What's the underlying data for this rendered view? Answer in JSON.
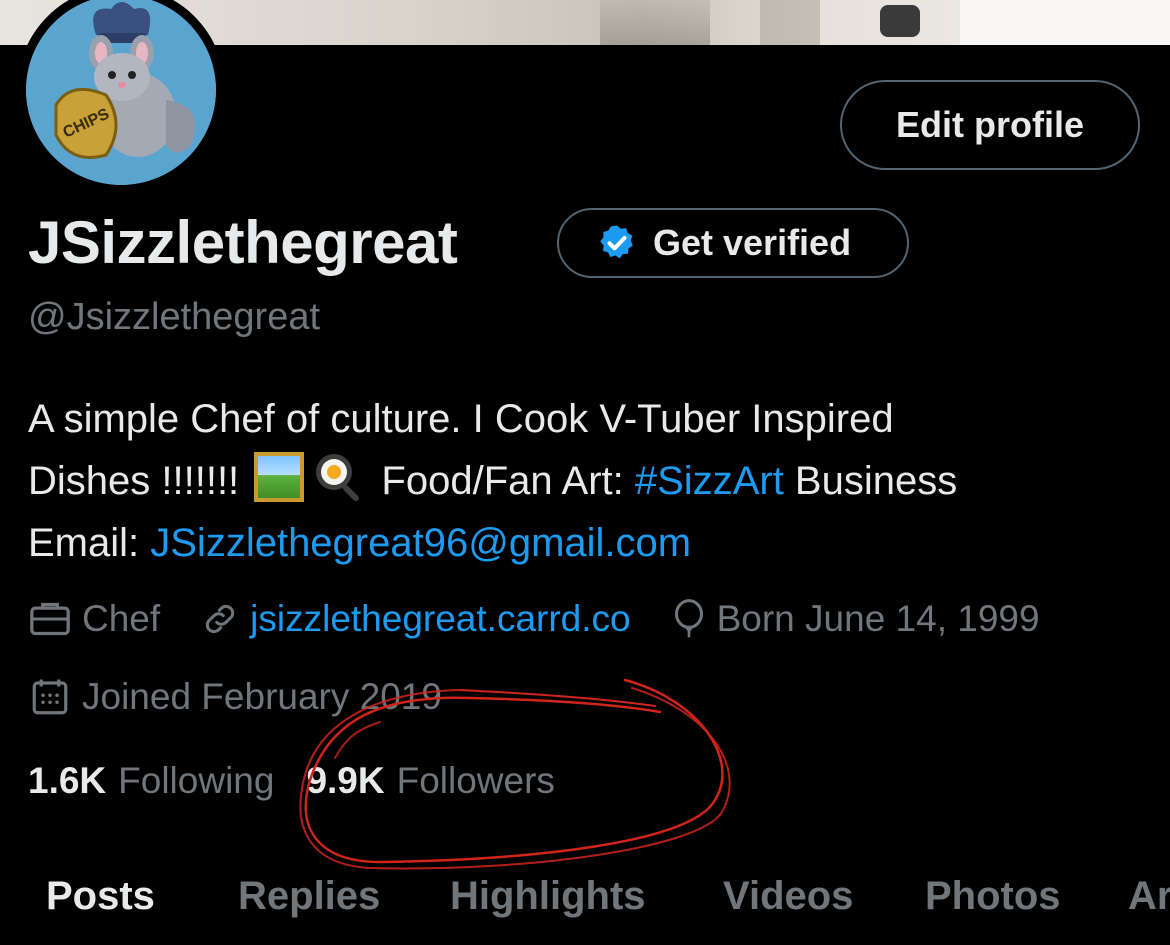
{
  "profile": {
    "display_name": "JSizzlethegreat",
    "handle": "@Jsizzlethegreat",
    "edit_profile_label": "Edit profile",
    "get_verified_label": "Get verified",
    "avatar_text": "CHIPS"
  },
  "bio": {
    "line1": "A simple Chef of culture. I Cook V-Tuber Inspired",
    "line2_prefix": "Dishes !!!!!!! ",
    "line2_mid": " Food/Fan Art: ",
    "hashtag": "#SizzArt",
    "line2_suffix": " Business",
    "line3_prefix": "Email: ",
    "email": "JSizzlethegreat96@gmail.com"
  },
  "meta": {
    "occupation": "Chef",
    "website": "jsizzlethegreat.carrd.co",
    "birthday": "Born June 14, 1999",
    "joined": "Joined February 2019"
  },
  "stats": {
    "following_count": "1.6K",
    "following_label": "Following",
    "followers_count": "9.9K",
    "followers_label": "Followers"
  },
  "tabs": [
    {
      "label": "Posts",
      "active": true
    },
    {
      "label": "Replies",
      "active": false
    },
    {
      "label": "Highlights",
      "active": false
    },
    {
      "label": "Videos",
      "active": false
    },
    {
      "label": "Photos",
      "active": false
    },
    {
      "label": "Ar",
      "active": false
    }
  ],
  "colors": {
    "background": "#000000",
    "text_primary": "#e7e9ea",
    "text_secondary": "#71767b",
    "link": "#1d9bf0",
    "border": "#536471",
    "annotation_red": "#d1241c"
  },
  "icons": {
    "verified": "verified-badge-icon",
    "occupation": "briefcase-icon",
    "website": "link-icon",
    "birthday": "balloon-icon",
    "joined": "calendar-icon",
    "emoji_1": "framed-picture-emoji",
    "emoji_2": "frying-egg-emoji"
  }
}
